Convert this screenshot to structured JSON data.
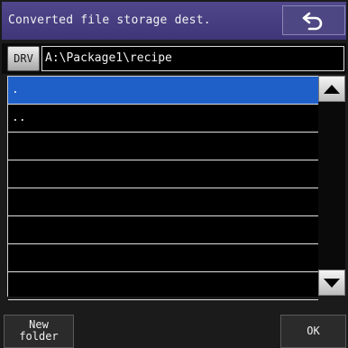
{
  "header": {
    "title": "Converted file storage dest.",
    "back_icon": "undo-arrow-icon"
  },
  "path_row": {
    "drive_label": "DRV",
    "path": "A:\\Package1\\recipe"
  },
  "file_list": {
    "items": [
      {
        "label": ".",
        "selected": true
      },
      {
        "label": "..",
        "selected": false
      },
      {
        "label": "",
        "selected": false
      },
      {
        "label": "",
        "selected": false
      },
      {
        "label": "",
        "selected": false
      },
      {
        "label": "",
        "selected": false
      },
      {
        "label": "",
        "selected": false
      },
      {
        "label": "",
        "selected": false
      }
    ]
  },
  "scrollbar": {
    "up_icon": "triangle-up-icon",
    "down_icon": "triangle-down-icon"
  },
  "footer": {
    "new_folder_line1": "New",
    "new_folder_line2": "folder",
    "ok_label": "OK"
  },
  "colors": {
    "header_bg": "#433b7e",
    "selection": "#1f5fc8",
    "background": "#1b1b1b"
  }
}
